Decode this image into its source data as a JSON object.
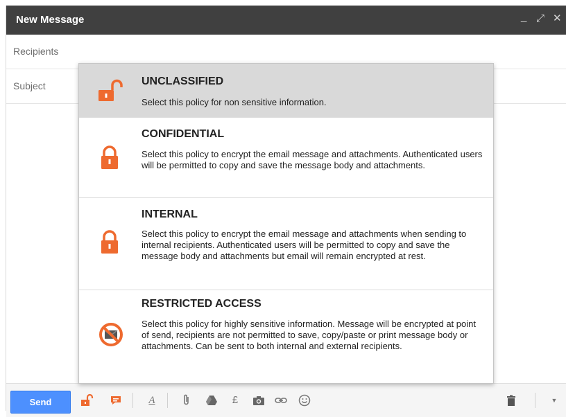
{
  "window": {
    "title": "New Message",
    "minimize": "_",
    "expand": "⤢",
    "close": "✕"
  },
  "fields": {
    "recipients_placeholder": "Recipients",
    "subject_placeholder": "Subject"
  },
  "policies": [
    {
      "name": "UNCLASSIFIED",
      "description": "Select this policy for non sensitive information.",
      "icon": "unlock-icon",
      "selected": true
    },
    {
      "name": "CONFIDENTIAL",
      "description": "Select this policy to encrypt the email message and attachments. Authenticated users will be permitted to copy and save the message body and attachments.",
      "icon": "lock-icon",
      "selected": false
    },
    {
      "name": "INTERNAL",
      "description": "Select this policy to encrypt the email message and attachments when sending to internal recipients. Authenticated users will be permitted to copy and save the message body and attachments but email will remain encrypted at rest.",
      "icon": "lock-icon",
      "selected": false
    },
    {
      "name": "RESTRICTED ACCESS",
      "description": "Select this policy for highly sensitive information. Message will be encrypted at point of send, recipients are not permitted to save, copy/paste or print message body or attachments. Can be sent to both internal and external recipients.",
      "icon": "no-email-icon",
      "selected": false
    }
  ],
  "toolbar": {
    "send_label": "Send",
    "icons": [
      "unlock-icon",
      "comment-icon",
      "text-format-icon",
      "attachment-icon",
      "drive-icon",
      "pound-icon",
      "camera-icon",
      "link-icon",
      "emoji-icon",
      "trash-icon",
      "more-options-icon"
    ]
  },
  "colors": {
    "accent_orange": "#ee6a2f",
    "send_blue": "#4d90fe",
    "titlebar": "#404040",
    "selected_row": "#d9d9d9"
  }
}
